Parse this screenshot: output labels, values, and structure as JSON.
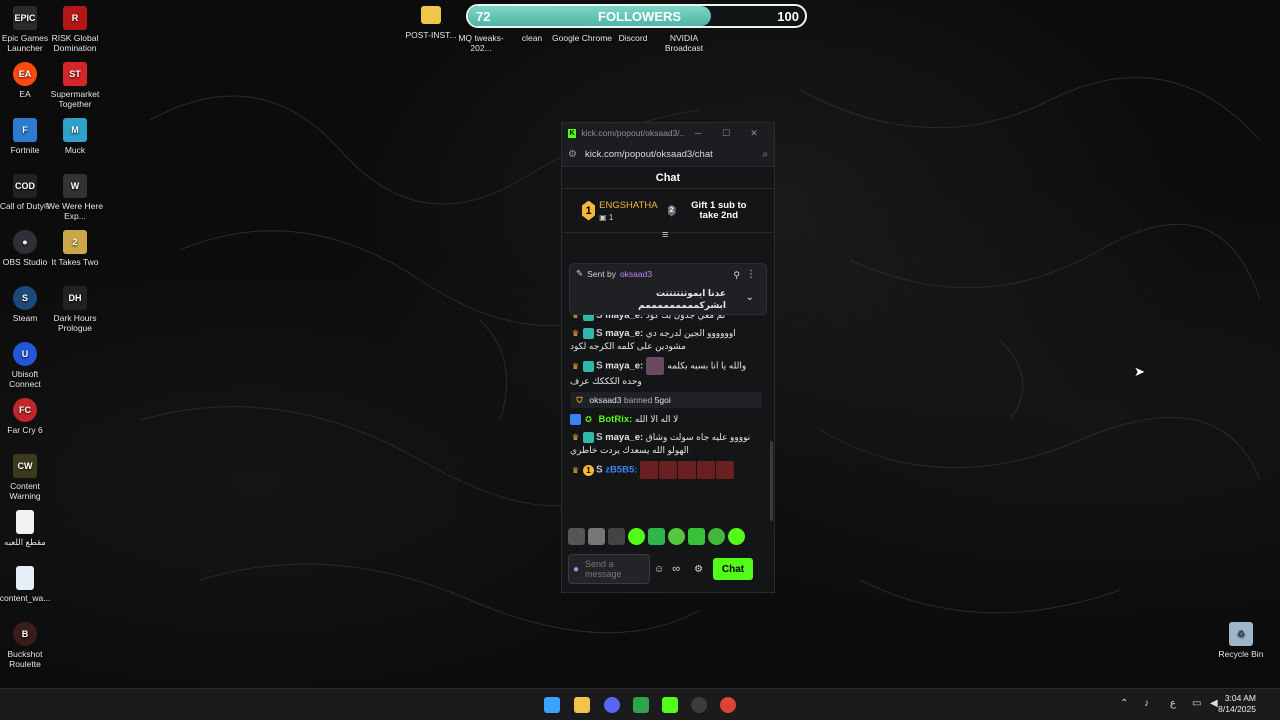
{
  "followers_bar": {
    "current": "72",
    "label": "FOLLOWERS",
    "goal": "100",
    "progress": 0.72
  },
  "desktop_icons": [
    {
      "name": "epic-games-icon",
      "label": "Epic Games Launcher",
      "color": "#2a2a2a",
      "glyph": "EPIC"
    },
    {
      "name": "risk-icon",
      "label": "RISK Global Domination",
      "color": "#b5161a",
      "glyph": "R"
    },
    {
      "name": "ea-icon",
      "label": "EA",
      "color": "#ff4b0f",
      "glyph": "EA"
    },
    {
      "name": "supermarket-icon",
      "label": "Supermarket Together",
      "color": "#d3262a",
      "glyph": "ST"
    },
    {
      "name": "fortnite-icon",
      "label": "Fortnite",
      "color": "#2e7bd1",
      "glyph": "F"
    },
    {
      "name": "muck-icon",
      "label": "Muck",
      "color": "#2fa2c9",
      "glyph": "M"
    },
    {
      "name": "call-of-duty-icon",
      "label": "Call of Duty®",
      "color": "#222",
      "glyph": "COD"
    },
    {
      "name": "we-were-here-icon",
      "label": "We Were Here Exp...",
      "color": "#333",
      "glyph": "W"
    },
    {
      "name": "obs-icon",
      "label": "OBS Studio",
      "color": "#302e36",
      "glyph": "●"
    },
    {
      "name": "it-takes-two-icon",
      "label": "It Takes Two",
      "color": "#caa84a",
      "glyph": "2"
    },
    {
      "name": "steam-icon",
      "label": "Steam",
      "color": "#1b4a7a",
      "glyph": "S"
    },
    {
      "name": "dark-hours-icon",
      "label": "Dark Hours Prologue",
      "color": "#222",
      "glyph": "DH"
    },
    {
      "name": "ubisoft-icon",
      "label": "Ubisoft Connect",
      "color": "#2456d8",
      "glyph": "U"
    },
    {
      "name": "far-cry-icon",
      "label": "Far Cry 6",
      "color": "#c0262a",
      "glyph": "FC"
    },
    {
      "name": "content-warning-icon",
      "label": "Content Warning",
      "color": "#3d3a1e",
      "glyph": "CW"
    },
    {
      "name": "arabic-file-icon",
      "label": "مقطع اللعبه",
      "color": "#f2f2f2",
      "glyph": ""
    },
    {
      "name": "content-file-icon",
      "label": "content_wa...",
      "color": "#e6eef7",
      "glyph": ""
    },
    {
      "name": "buckshot-icon",
      "label": "Buckshot Roulette",
      "color": "#3a1c1c",
      "glyph": "B"
    },
    {
      "name": "post-install-icon",
      "label": "POST-INST...",
      "color": "#f0c64a",
      "glyph": ""
    },
    {
      "name": "mq-tweaks-icon",
      "label": "MQ tweaks-202...",
      "color": "#555",
      "glyph": ""
    },
    {
      "name": "clean-icon",
      "label": "clean",
      "color": "#555",
      "glyph": ""
    },
    {
      "name": "chrome-icon",
      "label": "Google Chrome",
      "color": "#4285f4",
      "glyph": ""
    },
    {
      "name": "discord-icon",
      "label": "Discord",
      "color": "#5865f2",
      "glyph": ""
    },
    {
      "name": "nvidia-icon",
      "label": "NVIDIA Broadcast",
      "color": "#76b900",
      "glyph": ""
    },
    {
      "name": "recycle-bin-icon",
      "label": "Recycle Bin",
      "color": "#9fb6c9",
      "glyph": "♻"
    }
  ],
  "chat_window": {
    "tab_title": "kick.com/popout/oksaad3/...",
    "url": "kick.com/popout/oksaad3/chat",
    "header": "Chat",
    "top_gifter": {
      "rank": "1",
      "name": "ENGSHATHA",
      "count": "1"
    },
    "second_rank": "2",
    "gift_prompt": "Gift 1 sub to take 2nd",
    "pinned": {
      "sent_by": "Sent by",
      "author": "oksaad3",
      "text": "عدنا ايموتتتتتتت ابشركمممممممممم"
    },
    "messages": [
      {
        "user": "maya_e:",
        "user_color": "#c9c9c9",
        "text": "ئم معي جدول بك كود"
      },
      {
        "user": "maya_e:",
        "user_color": "#c9c9c9",
        "text": "اوووووو الجين لدرجه دي مشودين على كلمه الكرجه لكود"
      },
      {
        "user": "maya_e:",
        "user_color": "#c9c9c9",
        "text": "والله يا انا بسبه بكلمه وحده الكككك عرف"
      },
      {
        "ban_user": "oksaad3",
        "ban_text": "banned",
        "ban_target": "5goi"
      },
      {
        "user": "BotRix:",
        "user_color": "#53fc18",
        "text": "لا اله الا الله"
      },
      {
        "user": "maya_e:",
        "user_color": "#c9c9c9",
        "text": "نوووو عليه جاه سولت وشاق الهولو الله يسعدك يردت خاطري"
      },
      {
        "user": "zB5B5:",
        "user_color": "#3b82f6",
        "text": ""
      }
    ],
    "input_placeholder": "Send a message",
    "chat_button": "Chat"
  },
  "taskbar": {
    "time": "3:04 AM",
    "date": "8/14/2025",
    "lang": "ع"
  }
}
